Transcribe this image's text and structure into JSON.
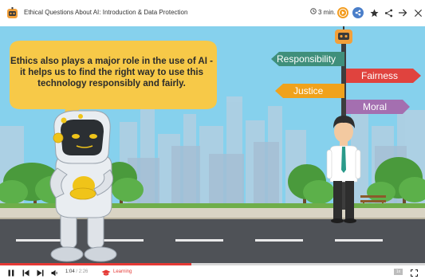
{
  "header": {
    "title": "Ethical Questions About AI: Introduction & Data Protection",
    "duration": "3 min.",
    "icons": {
      "logo": "robot-logo-icon",
      "clock": "clock-icon",
      "play": "play-circle-icon",
      "share_circle": "share-circle-icon",
      "star": "star-icon",
      "share": "share-icon",
      "forward": "arrow-right-icon",
      "close": "close-icon"
    },
    "colors": {
      "play": "#f39c1f",
      "share_circle": "#4a7ec9"
    }
  },
  "scene": {
    "bubble_text": "Ethics also plays a major role in the use of AI - it helps us to find the right way to use this technology responsibly and fairly.",
    "signs": {
      "responsibility": "Responsibility",
      "fairness": "Fairness",
      "justice": "Justice",
      "moral": "Moral"
    },
    "colors": {
      "sky": "#87d2ee",
      "bubble": "#f7c948",
      "responsibility": "#3f8f7b",
      "fairness": "#e0433e",
      "justice": "#f0a21c",
      "moral": "#a46fb0"
    }
  },
  "player": {
    "progress": 0.45,
    "current_time": "1:04",
    "total_time": "2:26",
    "course_label": "Learning",
    "speed": "1x",
    "icons": {
      "pause": "pause-icon",
      "prev": "skip-back-icon",
      "next": "skip-forward-icon",
      "volume": "volume-icon",
      "course": "graduation-cap-icon",
      "fullscreen": "fullscreen-icon"
    }
  }
}
